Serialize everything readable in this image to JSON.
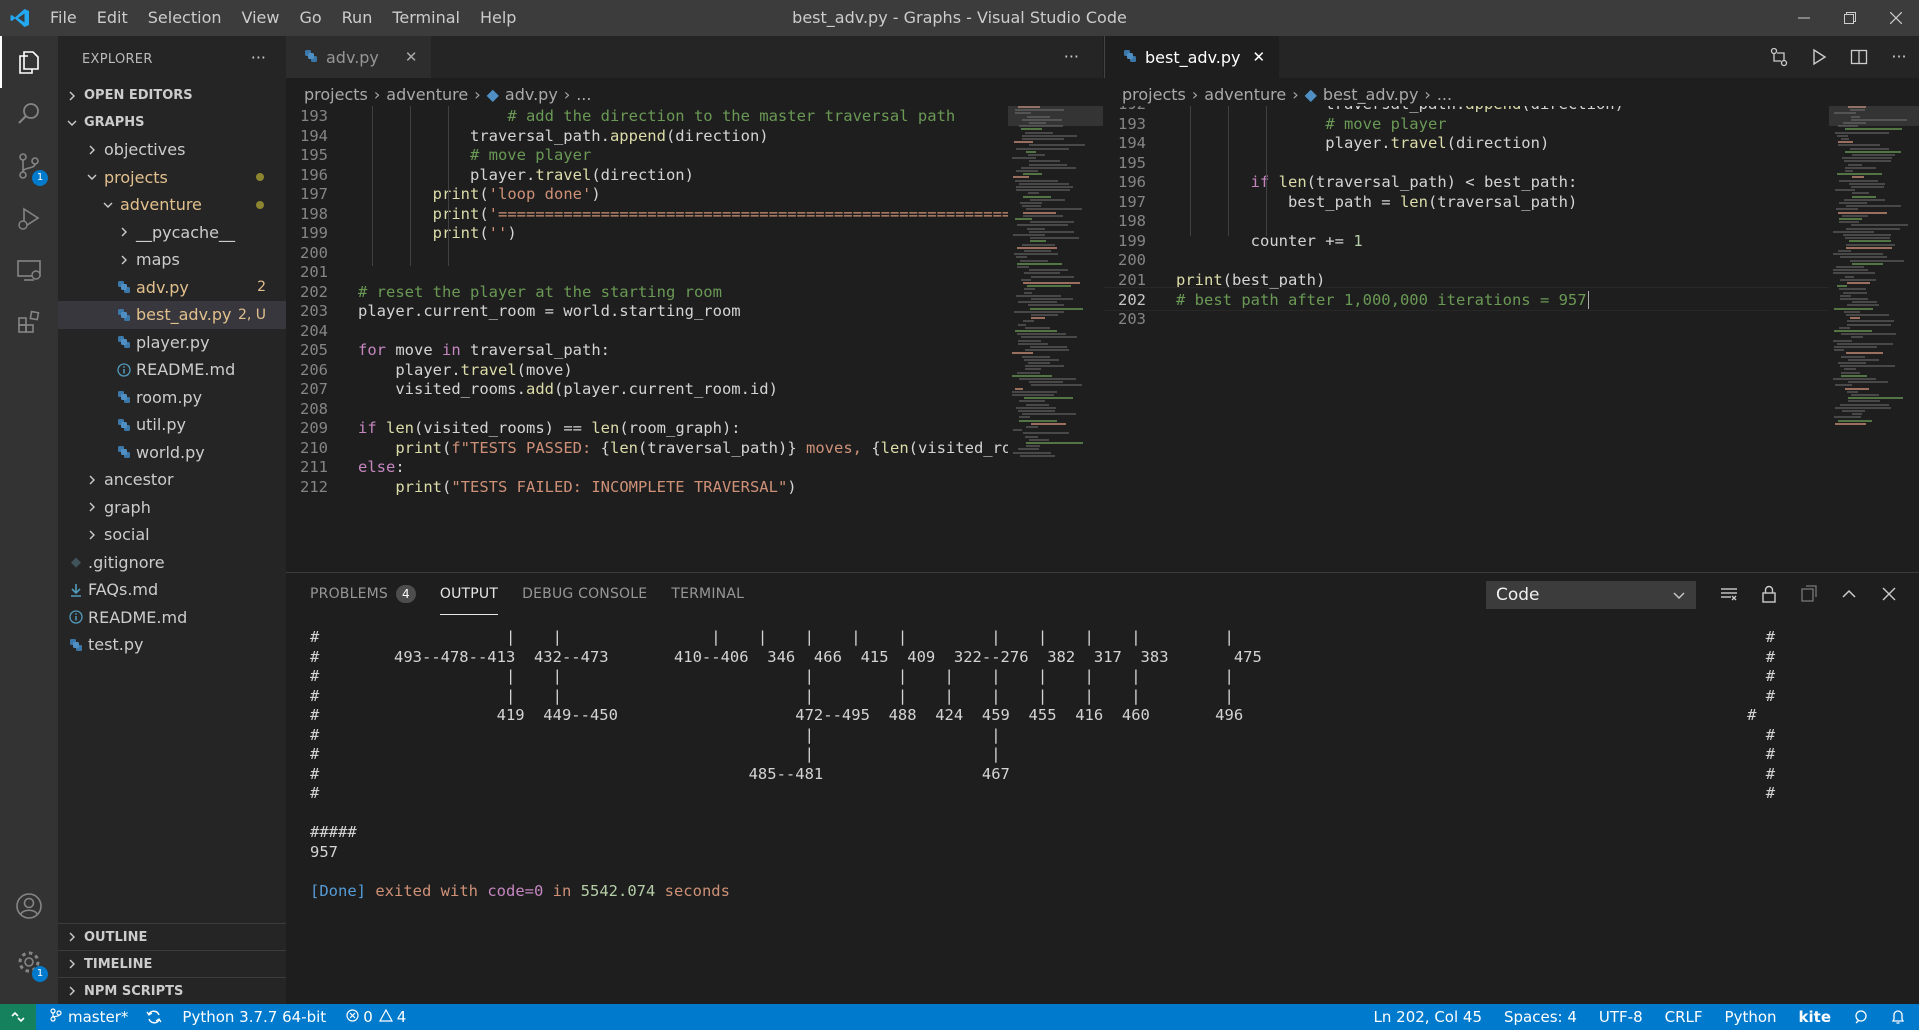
{
  "window": {
    "title": "best_adv.py - Graphs - Visual Studio Code"
  },
  "menu": [
    "File",
    "Edit",
    "Selection",
    "View",
    "Go",
    "Run",
    "Terminal",
    "Help"
  ],
  "activity": {
    "scm_badge": "1",
    "settings_badge": "1"
  },
  "sidebar": {
    "header": "EXPLORER",
    "more": "···",
    "open_editors": "OPEN EDITORS",
    "root": "GRAPHS",
    "items": [
      {
        "label": "objectives",
        "type": "folder",
        "depth": 1,
        "open": false
      },
      {
        "label": "projects",
        "type": "folder",
        "depth": 1,
        "open": true,
        "modified": true
      },
      {
        "label": "adventure",
        "type": "folder",
        "depth": 2,
        "open": true,
        "modified": true
      },
      {
        "label": "__pycache__",
        "type": "folder",
        "depth": 3,
        "open": false
      },
      {
        "label": "maps",
        "type": "folder",
        "depth": 3,
        "open": false
      },
      {
        "label": "adv.py",
        "type": "py",
        "depth": 3,
        "status": "2",
        "modified": true
      },
      {
        "label": "best_adv.py",
        "type": "py",
        "depth": 3,
        "status": "2, U",
        "modified": true,
        "selected": true
      },
      {
        "label": "player.py",
        "type": "py",
        "depth": 3
      },
      {
        "label": "README.md",
        "type": "info",
        "depth": 3
      },
      {
        "label": "room.py",
        "type": "py",
        "depth": 3
      },
      {
        "label": "util.py",
        "type": "py",
        "depth": 3
      },
      {
        "label": "world.py",
        "type": "py",
        "depth": 3
      },
      {
        "label": "ancestor",
        "type": "folder",
        "depth": 1,
        "open": false
      },
      {
        "label": "graph",
        "type": "folder",
        "depth": 1,
        "open": false
      },
      {
        "label": "social",
        "type": "folder",
        "depth": 1,
        "open": false
      },
      {
        "label": ".gitignore",
        "type": "git",
        "depth": 0
      },
      {
        "label": "FAQs.md",
        "type": "dl",
        "depth": 0
      },
      {
        "label": "README.md",
        "type": "info",
        "depth": 0
      },
      {
        "label": "test.py",
        "type": "py",
        "depth": 0
      }
    ],
    "outline": "OUTLINE",
    "timeline": "TIMELINE",
    "npm": "NPM SCRIPTS"
  },
  "left_editor": {
    "tab": "adv.py",
    "more": "···",
    "breadcrumb": [
      "projects",
      "adventure",
      "adv.py",
      "..."
    ],
    "lines": [
      {
        "n": "193",
        "t": [
          [
            "                ",
            ""
          ],
          [
            "# add the direction to the master traversal path",
            "cm"
          ]
        ]
      },
      {
        "n": "194",
        "t": [
          [
            "            traversal_path.",
            "op"
          ],
          [
            "append",
            "fn"
          ],
          [
            "(direction)",
            "op"
          ]
        ]
      },
      {
        "n": "195",
        "t": [
          [
            "            ",
            ""
          ],
          [
            "# move player",
            "cm"
          ]
        ]
      },
      {
        "n": "196",
        "t": [
          [
            "            player.",
            "op"
          ],
          [
            "travel",
            "fn"
          ],
          [
            "(direction)",
            "op"
          ]
        ]
      },
      {
        "n": "197",
        "t": [
          [
            "        ",
            ""
          ],
          [
            "print",
            "fn"
          ],
          [
            "(",
            "op"
          ],
          [
            "'loop done'",
            "str"
          ],
          [
            ")",
            "op"
          ]
        ]
      },
      {
        "n": "198",
        "t": [
          [
            "        ",
            ""
          ],
          [
            "print",
            "fn"
          ],
          [
            "(",
            "op"
          ],
          [
            "'====================================================================",
            "str"
          ]
        ]
      },
      {
        "n": "199",
        "t": [
          [
            "        ",
            ""
          ],
          [
            "print",
            "fn"
          ],
          [
            "(",
            "op"
          ],
          [
            "''",
            "str"
          ],
          [
            ")",
            "op"
          ]
        ]
      },
      {
        "n": "200",
        "t": [
          [
            "",
            ""
          ]
        ]
      },
      {
        "n": "201",
        "t": [
          [
            "",
            ""
          ]
        ]
      },
      {
        "n": "202",
        "t": [
          [
            "",
            ""
          ],
          [
            "# reset the player at the starting room",
            "cm"
          ]
        ]
      },
      {
        "n": "203",
        "t": [
          [
            "player.current_room = world.starting_room",
            "op"
          ]
        ]
      },
      {
        "n": "204",
        "t": [
          [
            "",
            ""
          ]
        ]
      },
      {
        "n": "205",
        "t": [
          [
            "",
            ""
          ],
          [
            "for",
            "kw"
          ],
          [
            " move ",
            "op"
          ],
          [
            "in",
            "kw"
          ],
          [
            " traversal_path:",
            "op"
          ]
        ]
      },
      {
        "n": "206",
        "t": [
          [
            "    player.",
            "op"
          ],
          [
            "travel",
            "fn"
          ],
          [
            "(move)",
            "op"
          ]
        ]
      },
      {
        "n": "207",
        "t": [
          [
            "    visited_rooms.",
            "op"
          ],
          [
            "add",
            "fn"
          ],
          [
            "(player.current_room.id)",
            "op"
          ]
        ]
      },
      {
        "n": "208",
        "t": [
          [
            "",
            ""
          ]
        ]
      },
      {
        "n": "209",
        "t": [
          [
            "",
            ""
          ],
          [
            "if",
            "kw"
          ],
          [
            " ",
            "op"
          ],
          [
            "len",
            "fn"
          ],
          [
            "(visited_rooms) == ",
            "op"
          ],
          [
            "len",
            "fn"
          ],
          [
            "(room_graph):",
            "op"
          ]
        ]
      },
      {
        "n": "210",
        "t": [
          [
            "    ",
            ""
          ],
          [
            "print",
            "fn"
          ],
          [
            "(",
            "op"
          ],
          [
            "f\"TESTS PASSED: ",
            "str"
          ],
          [
            "{",
            "op"
          ],
          [
            "len",
            "fn"
          ],
          [
            "(traversal_path)",
            "op"
          ],
          [
            "}",
            "op"
          ],
          [
            " moves, ",
            "str"
          ],
          [
            "{",
            "op"
          ],
          [
            "len",
            "fn"
          ],
          [
            "(visited_rooms)",
            "op"
          ]
        ]
      },
      {
        "n": "211",
        "t": [
          [
            "",
            ""
          ],
          [
            "else",
            "kw"
          ],
          [
            ":",
            "op"
          ]
        ]
      },
      {
        "n": "212",
        "t": [
          [
            "    ",
            ""
          ],
          [
            "print",
            "fn"
          ],
          [
            "(",
            "op"
          ],
          [
            "\"TESTS FAILED: INCOMPLETE TRAVERSAL\"",
            "str"
          ],
          [
            ")",
            "op"
          ]
        ]
      }
    ]
  },
  "right_editor": {
    "tab": "best_adv.py",
    "breadcrumb": [
      "projects",
      "adventure",
      "best_adv.py",
      "..."
    ],
    "lines": [
      {
        "n": "192",
        "t": [
          [
            "                traversal_path.",
            "op"
          ],
          [
            "append",
            "fn"
          ],
          [
            "(direction)",
            "op"
          ]
        ]
      },
      {
        "n": "193",
        "t": [
          [
            "                ",
            ""
          ],
          [
            "# move player",
            "cm"
          ]
        ]
      },
      {
        "n": "194",
        "t": [
          [
            "                player.",
            "op"
          ],
          [
            "travel",
            "fn"
          ],
          [
            "(direction)",
            "op"
          ]
        ]
      },
      {
        "n": "195",
        "t": [
          [
            "",
            ""
          ]
        ]
      },
      {
        "n": "196",
        "t": [
          [
            "        ",
            ""
          ],
          [
            "if",
            "kw"
          ],
          [
            " ",
            "op"
          ],
          [
            "len",
            "fn"
          ],
          [
            "(traversal_path) < best_path:",
            "op"
          ]
        ]
      },
      {
        "n": "197",
        "t": [
          [
            "            best_path = ",
            "op"
          ],
          [
            "len",
            "fn"
          ],
          [
            "(traversal_path)",
            "op"
          ]
        ]
      },
      {
        "n": "198",
        "t": [
          [
            "",
            ""
          ]
        ]
      },
      {
        "n": "199",
        "t": [
          [
            "        counter += ",
            "op"
          ],
          [
            "1",
            "num"
          ]
        ]
      },
      {
        "n": "200",
        "t": [
          [
            "",
            ""
          ]
        ]
      },
      {
        "n": "201",
        "t": [
          [
            "",
            ""
          ],
          [
            "print",
            "fn"
          ],
          [
            "(best_path)",
            "op"
          ]
        ]
      },
      {
        "n": "202",
        "t": [
          [
            "",
            ""
          ],
          [
            "# best path after 1,000,000 iterations = 957",
            "cm"
          ]
        ],
        "current": true
      },
      {
        "n": "203",
        "t": [
          [
            "",
            ""
          ]
        ]
      }
    ]
  },
  "panel": {
    "tabs": [
      "PROBLEMS",
      "OUTPUT",
      "DEBUG CONSOLE",
      "TERMINAL"
    ],
    "problems_count": "4",
    "active": "OUTPUT",
    "channel": "Code",
    "output": [
      "#                    |    |                |    |    |    |    |         |    |    |    |         |                                                         #",
      "#        493--478--413  432--473       410--406  346  466  415  409  322--276  382  317  383       475                                                      #",
      "#                    |    |                          |         |    |    |    |    |    |         |                                                         #",
      "#                    |    |                          |         |    |    |    |    |    |         |                                                         #",
      "#                   419  449--450                   472--495  488  424  459  455  416  460       496                                                      #",
      "#                                                    |                   |                                                                                  #",
      "#                                                    |                   |                                                                                  #",
      "#                                              485--481                 467                                                                                 #",
      "#                                                                                                                                                           #",
      "",
      "#####",
      "957",
      "",
      ""
    ],
    "done": {
      "tag": "[Done]",
      "pre": " exited with ",
      "code": "code=0",
      "mid": " in ",
      "secs": "5542.074",
      "post": " seconds"
    }
  },
  "status": {
    "branch": "master*",
    "python": "Python 3.7.7 64-bit",
    "errors": "0",
    "warnings": "4",
    "cursor": "Ln 202, Col 45",
    "spaces": "Spaces: 4",
    "encoding": "UTF-8",
    "eol": "CRLF",
    "language": "Python",
    "kite": "kite"
  }
}
